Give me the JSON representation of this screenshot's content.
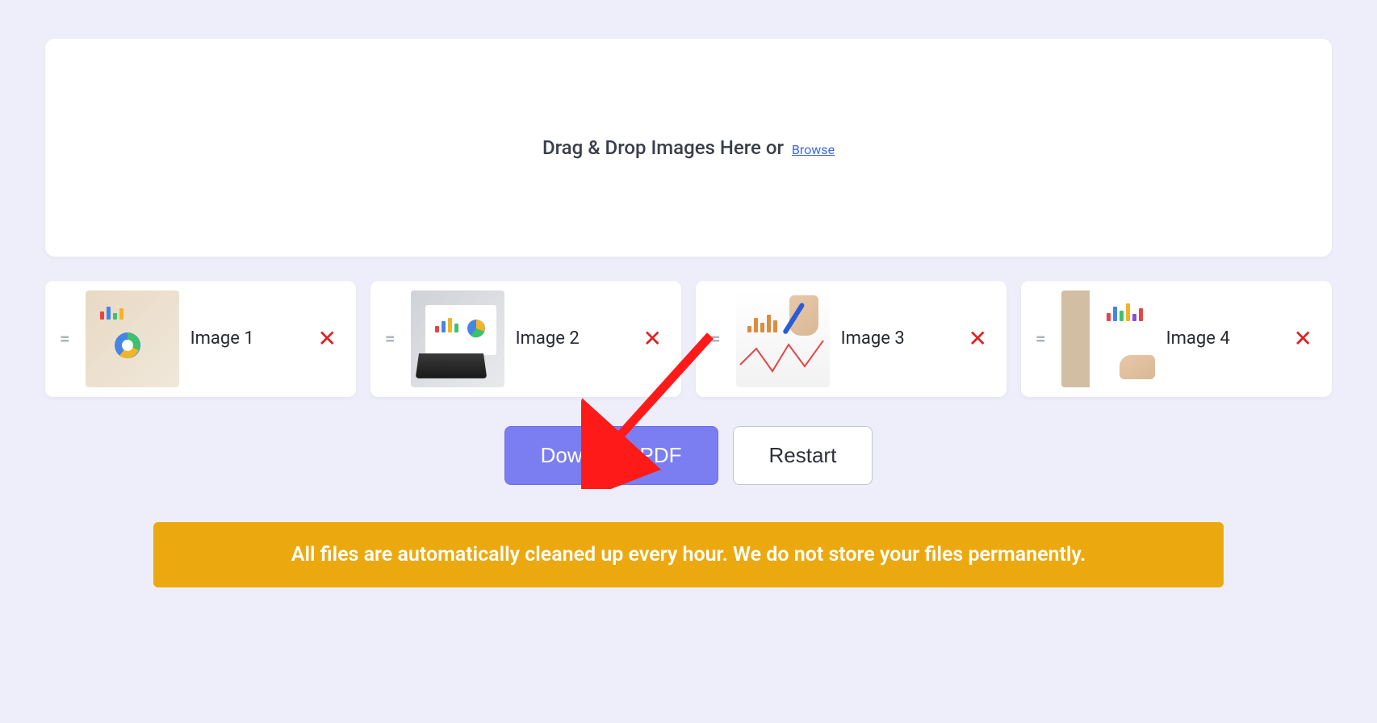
{
  "dropzone": {
    "text": "Drag & Drop Images Here or",
    "browse_label": "Browse"
  },
  "thumbnails": [
    {
      "label": "Image 1"
    },
    {
      "label": "Image 2"
    },
    {
      "label": "Image 3"
    },
    {
      "label": "Image 4"
    }
  ],
  "actions": {
    "download_label": "Download PDF",
    "restart_label": "Restart"
  },
  "info_banner": "All files are automatically cleaned up every hour. We do not store your files permanently.",
  "colors": {
    "accent": "#7b7ef0",
    "link": "#3a63ff",
    "danger": "#e02020",
    "warning": "#eca90f",
    "arrow": "#ff1a1a"
  }
}
